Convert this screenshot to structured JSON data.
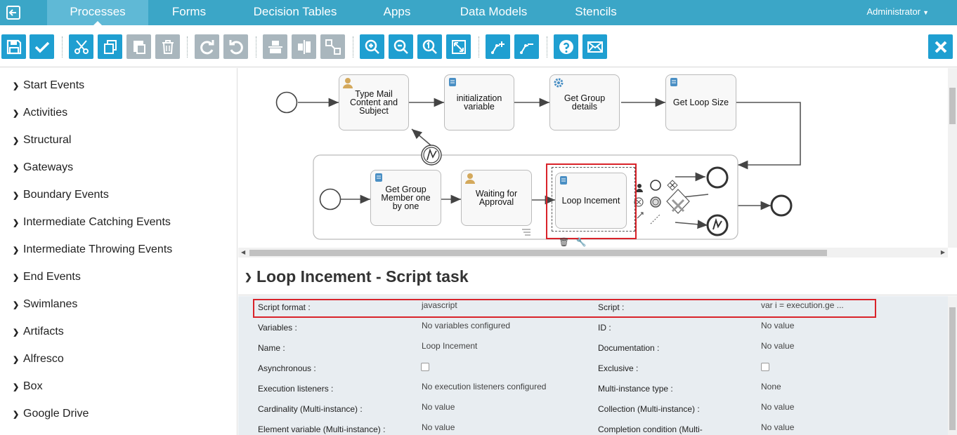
{
  "nav": {
    "tabs": [
      "Processes",
      "Forms",
      "Decision Tables",
      "Apps",
      "Data Models",
      "Stencils"
    ],
    "user": "Administrator"
  },
  "palette": {
    "items": [
      "Start Events",
      "Activities",
      "Structural",
      "Gateways",
      "Boundary Events",
      "Intermediate Catching Events",
      "Intermediate Throwing Events",
      "End Events",
      "Swimlanes",
      "Artifacts",
      "Alfresco",
      "Box",
      "Google Drive"
    ]
  },
  "diagram": {
    "tasks": {
      "type_mail": "Type Mail Content and Subject",
      "init_var": "initialization variable",
      "get_group": "Get Group details",
      "get_loop": "Get Loop Size",
      "get_member": "Get Group Member one by one",
      "waiting": "Waiting for Approval",
      "loop_inc": "Loop Incement"
    }
  },
  "properties": {
    "title": "Loop Incement - Script task",
    "rows": [
      {
        "l1": "Script format :",
        "v1": "javascript",
        "l2": "Script :",
        "v2": "var i = execution.ge ..."
      },
      {
        "l1": "Variables :",
        "v1": "No variables configured",
        "l2": "ID :",
        "v2": "No value"
      },
      {
        "l1": "Name :",
        "v1": "Loop Incement",
        "l2": "Documentation :",
        "v2": "No value"
      },
      {
        "l1": "Asynchronous :",
        "v1": "",
        "l2": "Exclusive :",
        "v2": ""
      },
      {
        "l1": "Execution listeners :",
        "v1": "No execution listeners configured",
        "l2": "Multi-instance type :",
        "v2": "None"
      },
      {
        "l1": "Cardinality (Multi-instance) :",
        "v1": "No value",
        "l2": "Collection (Multi-instance) :",
        "v2": "No value"
      },
      {
        "l1": "Element variable (Multi-instance) :",
        "v1": "No value",
        "l2": "Completion condition (Multi-",
        "v2": "No value"
      }
    ]
  }
}
